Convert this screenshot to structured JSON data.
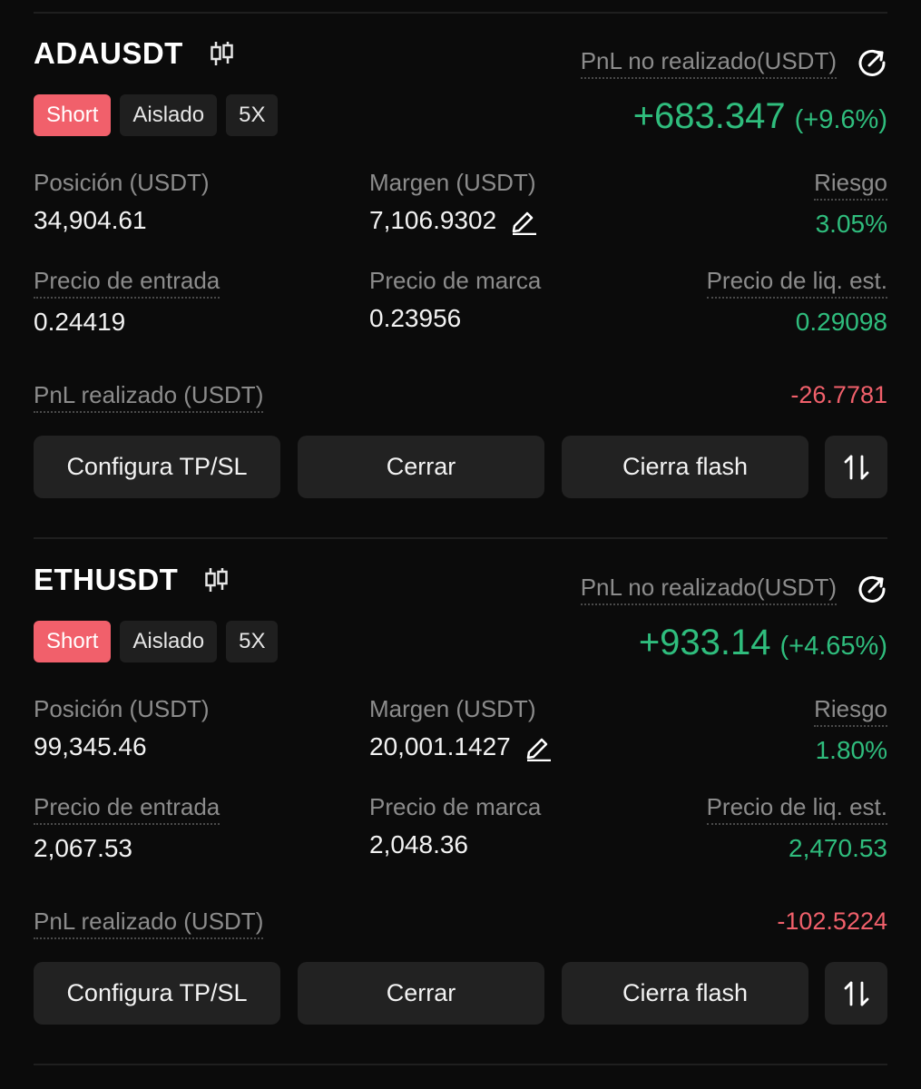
{
  "positions": [
    {
      "symbol": "ADAUSDT",
      "side": "Short",
      "margin_mode": "Aislado",
      "leverage": "5X",
      "unrealized_label": "PnL no realizado(USDT)",
      "unrealized_value": "+683.347",
      "unrealized_pct": "(+9.6%)",
      "position_label": "Posición (USDT)",
      "position_value": "34,904.61",
      "margin_label": "Margen (USDT)",
      "margin_value": "7,106.9302",
      "risk_label": "Riesgo",
      "risk_value": "3.05%",
      "entry_label": "Precio de entrada",
      "entry_value": "0.24419",
      "mark_label": "Precio de marca",
      "mark_value": "0.23956",
      "liq_label": "Precio de liq. est.",
      "liq_value": "0.29098",
      "realized_label": "PnL realizado (USDT)",
      "realized_value": "-26.7781",
      "btn_tpsl": "Configura TP/SL",
      "btn_close": "Cerrar",
      "btn_flash": "Cierra flash"
    },
    {
      "symbol": "ETHUSDT",
      "side": "Short",
      "margin_mode": "Aislado",
      "leverage": "5X",
      "unrealized_label": "PnL no realizado(USDT)",
      "unrealized_value": "+933.14",
      "unrealized_pct": "(+4.65%)",
      "position_label": "Posición (USDT)",
      "position_value": "99,345.46",
      "margin_label": "Margen (USDT)",
      "margin_value": "20,001.1427",
      "risk_label": "Riesgo",
      "risk_value": "1.80%",
      "entry_label": "Precio de entrada",
      "entry_value": "2,067.53",
      "mark_label": "Precio de marca",
      "mark_value": "2,048.36",
      "liq_label": "Precio de liq. est.",
      "liq_value": "2,470.53",
      "realized_label": "PnL realizado (USDT)",
      "realized_value": "-102.5224",
      "btn_tpsl": "Configura TP/SL",
      "btn_close": "Cerrar",
      "btn_flash": "Cierra flash"
    }
  ],
  "icons": {
    "chart": "candlestick-chart-icon",
    "share": "share-icon",
    "edit": "edit-margin-icon",
    "reverse": "reverse-position-icon"
  },
  "colors": {
    "profit": "#2fbd7d",
    "loss": "#f1606b",
    "background": "#0b0b0b",
    "button": "#222222"
  }
}
